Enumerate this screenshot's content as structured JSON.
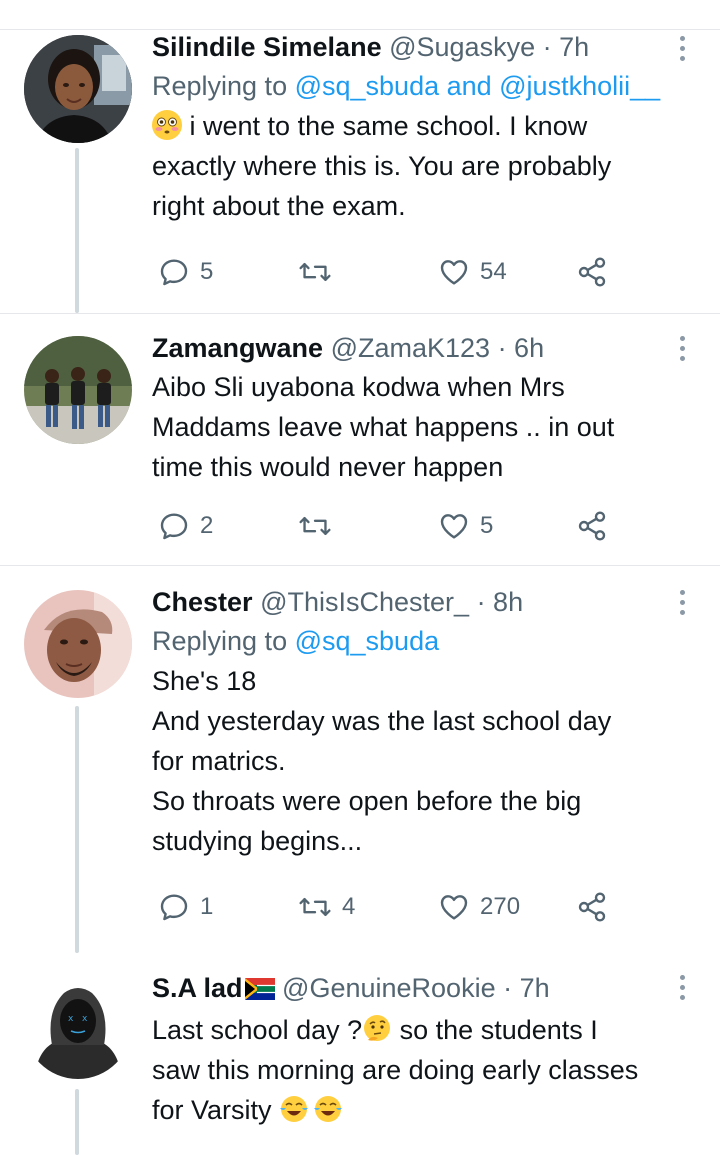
{
  "tweets": [
    {
      "name": "Silindile Simelane",
      "handle": "@Sugaskye",
      "time": "· 7h",
      "replying_prefix": "Replying to ",
      "replying_to": "@sq_sbuda and @justkholii__",
      "lines": [
        "i went to the same school. I know",
        "exactly where this is. You are probably",
        "right about the exam."
      ],
      "replies": "5",
      "retweets": "",
      "likes": "54"
    },
    {
      "name": "Zamangwane",
      "handle": "@ZamaK123",
      "time": "· 6h",
      "lines": [
        "Aibo Sli uyabona kodwa when Mrs",
        "Maddams leave what happens .. in out",
        "time this would never happen"
      ],
      "replies": "2",
      "retweets": "",
      "likes": "5"
    },
    {
      "name": "Chester",
      "handle": "@ThisIsChester_",
      "time": "· 8h",
      "replying_prefix": "Replying to ",
      "replying_to": "@sq_sbuda",
      "lines": [
        "She's 18",
        "And yesterday was the last school day",
        "for matrics.",
        "So throats were open before the big",
        "studying begins..."
      ],
      "replies": "1",
      "retweets": "4",
      "likes": "270"
    },
    {
      "name": "S.A lad",
      "handle": "@GenuineRookie",
      "time": "· 7h",
      "lines": [
        "Last school day ?",
        "saw this morning are doing early classes",
        "for Varsity"
      ],
      "line1_suffix": " so the students I"
    }
  ],
  "icons": {
    "reply": "reply-icon",
    "retweet": "retweet-icon",
    "like": "heart-icon",
    "share": "share-icon",
    "more": "more-vertical-icon"
  },
  "colors": {
    "link": "#1d9bf0",
    "secondary_text": "#536471",
    "thread_line": "#cfd9de"
  }
}
